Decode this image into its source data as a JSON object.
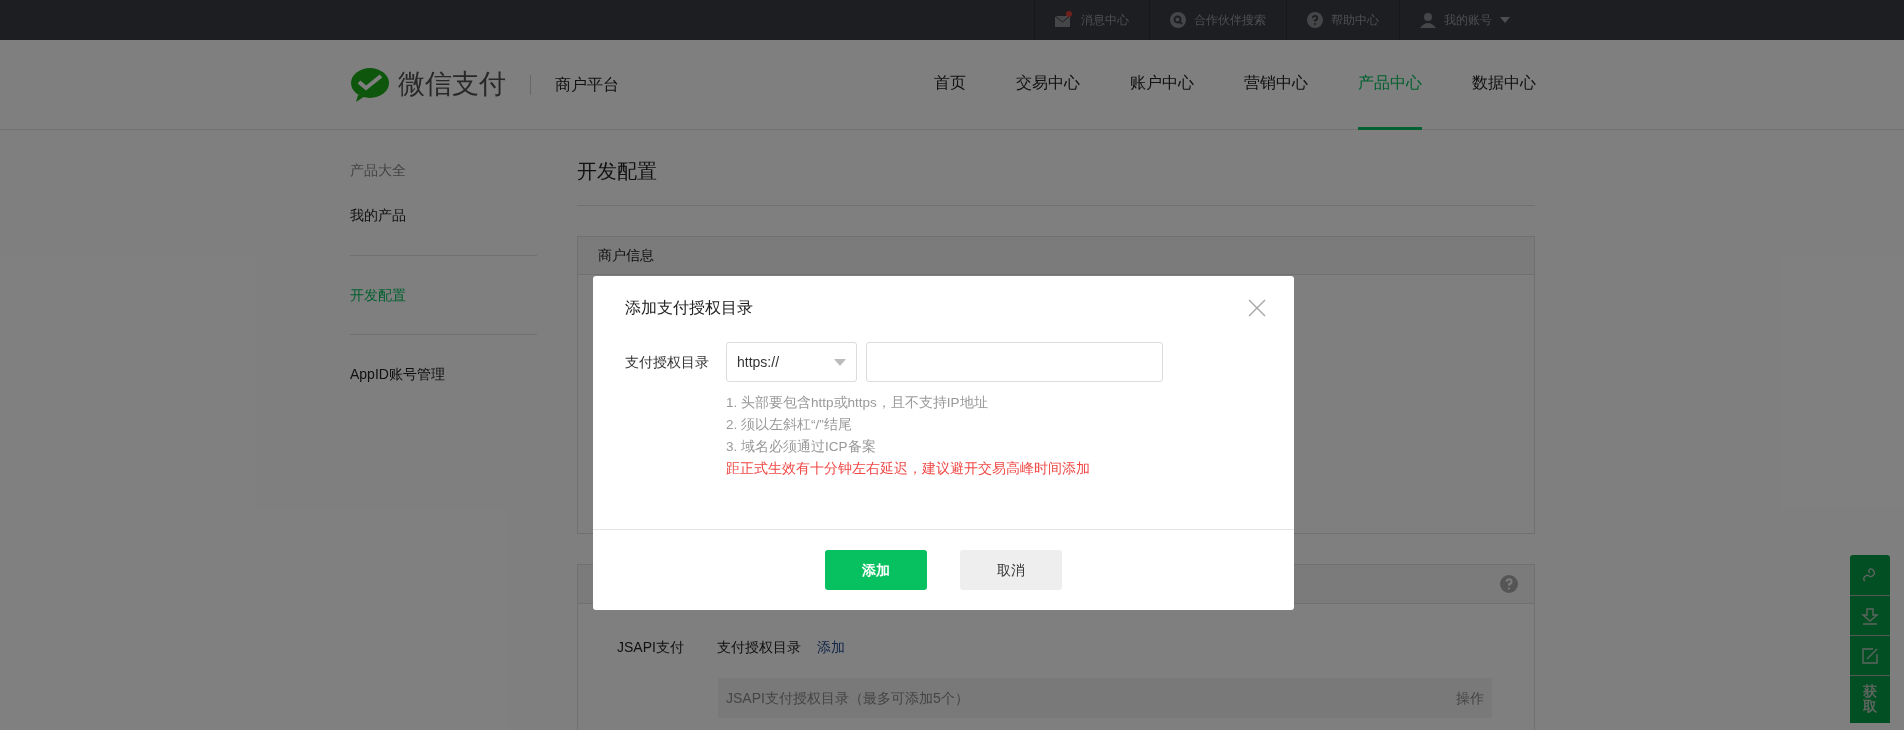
{
  "top_bar": {
    "links": [
      {
        "kind": "mail",
        "label": "消息中心",
        "unread": true
      },
      {
        "kind": "search",
        "label": "合作伙伴搜索",
        "unread": false
      },
      {
        "kind": "help",
        "label": "帮助中心",
        "unread": false
      },
      {
        "kind": "user",
        "label": "我的账号",
        "unread": false
      }
    ]
  },
  "header": {
    "logo_text": "微信支付",
    "platform": "商户平台",
    "nav": [
      {
        "label": "首页",
        "selected": false
      },
      {
        "label": "交易中心",
        "selected": false
      },
      {
        "label": "账户中心",
        "selected": false
      },
      {
        "label": "营销中心",
        "selected": false
      },
      {
        "label": "产品中心",
        "selected": true
      },
      {
        "label": "数据中心",
        "selected": false
      }
    ]
  },
  "sidebar": {
    "groups": [
      [
        {
          "kind": "heading",
          "label": "产品大全",
          "selected": false
        },
        {
          "kind": "link",
          "label": "我的产品",
          "selected": false
        }
      ],
      [
        {
          "kind": "link",
          "label": "开发配置",
          "selected": true
        }
      ],
      [
        {
          "kind": "link",
          "label": "AppID账号管理",
          "selected": false
        }
      ]
    ]
  },
  "page_title": "开发配置",
  "merchant_panel": {
    "title": "商户信息"
  },
  "payment_panel": {
    "row": {
      "product": "JSAPI支付",
      "field": "支付授权目录",
      "action": "添加"
    },
    "table": {
      "columns": [
        "JSAPI支付授权目录（最多可添加5个）",
        "操作"
      ]
    }
  },
  "dialog": {
    "title": "添加支付授权目录",
    "field_label": "支付授权目录",
    "protocol": "https://",
    "hints": [
      "1. 头部要包含http或https，且不支持IP地址",
      "2. 须以左斜杠“/”结尾",
      "3. 域名必须通过ICP备案"
    ],
    "warning": "距正式生效有十分钟左右延迟，建议避开交易高峰时间添加",
    "buttons": [
      {
        "kind": "primary",
        "label": "添加"
      },
      {
        "kind": "secondary",
        "label": "取消"
      }
    ]
  },
  "float_bar": {
    "items": [
      {
        "kind": "link"
      },
      {
        "kind": "download"
      },
      {
        "kind": "edit"
      },
      {
        "kind": "text",
        "label": "获取"
      }
    ]
  }
}
